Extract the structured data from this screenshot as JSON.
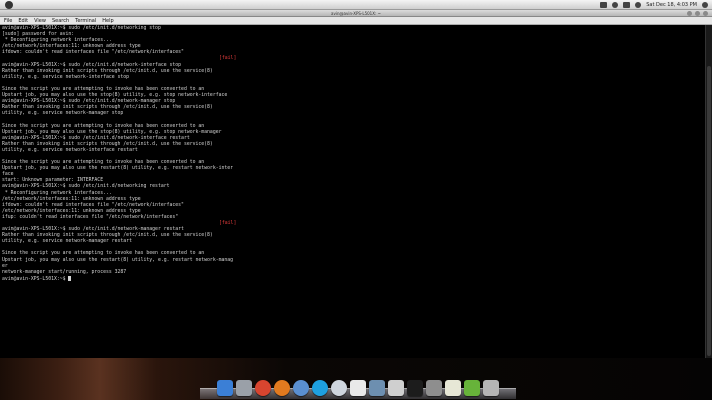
{
  "system_bar": {
    "clock": "Sat Dec 18, 4:03 PM"
  },
  "window": {
    "title": "avin@avin-XPS-L501X: ~",
    "menu": [
      "File",
      "Edit",
      "View",
      "Search",
      "Terminal",
      "Help"
    ]
  },
  "terminal": {
    "lines": [
      "avin@avin-XPS-L501X:~$ sudo /etc/init.d/networking stop",
      "[sudo] password for avin:",
      " * Deconfiguring network interfaces...",
      "/etc/network/interfaces:11: unknown address type",
      "ifdown: couldn't read interfaces file \"/etc/network/interfaces\"",
      "[fail]",
      "avin@avin-XPS-L501X:~$ sudo /etc/init.d/network-interface stop",
      "Rather than invoking init scripts through /etc/init.d, use the service(8)",
      "utility, e.g. service network-interface stop",
      "",
      "Since the script you are attempting to invoke has been converted to an",
      "Upstart job, you may also use the stop(8) utility, e.g. stop network-interface",
      "avin@avin-XPS-L501X:~$ sudo /etc/init.d/network-manager stop",
      "Rather than invoking init scripts through /etc/init.d, use the service(8)",
      "utility, e.g. service network-manager stop",
      "",
      "Since the script you are attempting to invoke has been converted to an",
      "Upstart job, you may also use the stop(8) utility, e.g. stop network-manager",
      "avin@avin-XPS-L501X:~$ sudo /etc/init.d/network-interface restart",
      "Rather than invoking init scripts through /etc/init.d, use the service(8)",
      "utility, e.g. service network-interface restart",
      "",
      "Since the script you are attempting to invoke has been converted to an",
      "Upstart job, you may also use the restart(8) utility, e.g. restart network-inter",
      "face",
      "start: Unknown parameter: INTERFACE",
      "avin@avin-XPS-L501X:~$ sudo /etc/init.d/networking restart",
      " * Reconfiguring network interfaces...",
      "/etc/network/interfaces:11: unknown address type",
      "ifdown: couldn't read interfaces file \"/etc/network/interfaces\"",
      "/etc/network/interfaces:11: unknown address type",
      "ifup: couldn't read interfaces file \"/etc/network/interfaces\"",
      "[fail]",
      "avin@avin-XPS-L501X:~$ sudo /etc/init.d/network-manager restart",
      "Rather than invoking init scripts through /etc/init.d, use the service(8)",
      "utility, e.g. service network-manager restart",
      "",
      "Since the script you are attempting to invoke has been converted to an",
      "Upstart job, you may also use the restart(8) utility, e.g. restart network-manag",
      "er",
      "network-manager start/running, process 3287",
      "avin@avin-XPS-L501X:~$ "
    ]
  },
  "dock": {
    "icons": [
      {
        "name": "finder-icon",
        "color": "#3b7fd6",
        "round": false
      },
      {
        "name": "system-icon",
        "color": "#9aa0a8",
        "round": false
      },
      {
        "name": "chrome-icon",
        "color": "#d8452f",
        "round": true
      },
      {
        "name": "firefox-icon",
        "color": "#e27a1f",
        "round": true
      },
      {
        "name": "network-icon",
        "color": "#5a8fd0",
        "round": true
      },
      {
        "name": "skype-icon",
        "color": "#1ea0e0",
        "round": true
      },
      {
        "name": "safari-icon",
        "color": "#cfd6de",
        "round": true
      },
      {
        "name": "calendar-icon",
        "color": "#e9e9e9",
        "round": false
      },
      {
        "name": "photo-icon",
        "color": "#6d8fb0",
        "round": false
      },
      {
        "name": "preview-icon",
        "color": "#cfcfcf",
        "round": false
      },
      {
        "name": "terminal-icon",
        "color": "#1c1c1c",
        "round": false
      },
      {
        "name": "settings-icon",
        "color": "#8e8e8e",
        "round": false
      },
      {
        "name": "editor-icon",
        "color": "#e7e7d6",
        "round": false
      },
      {
        "name": "download-icon",
        "color": "#67b33a",
        "round": false
      },
      {
        "name": "trash-icon",
        "color": "#b5b5b5",
        "round": false
      }
    ]
  }
}
